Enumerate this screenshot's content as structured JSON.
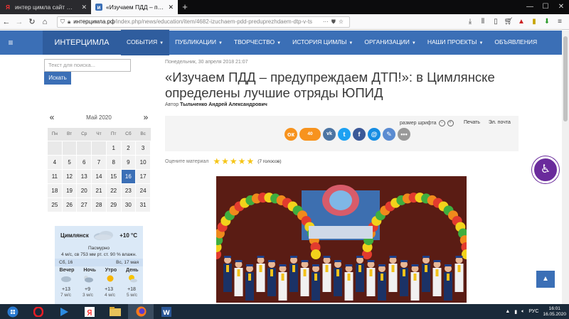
{
  "browser": {
    "tabs": [
      {
        "title": "интер цимла сайт — Яндекс: н",
        "icon": "yandex-icon",
        "active": false
      },
      {
        "title": "«Изучаем ПДД – предупрежда",
        "icon": "site-icon",
        "active": true
      }
    ],
    "url_host": "интерцимла.рф",
    "url_path": "/index.php/news/education/item/4682-izuchaem-pdd-preduprezhdaem-dtp-v-ts"
  },
  "site": {
    "logo": "ИНТЕРЦИМЛА",
    "menu": [
      {
        "label": "СОБЫТИЯ",
        "dropdown": true,
        "active": true
      },
      {
        "label": "ПУБЛИКАЦИИ",
        "dropdown": true
      },
      {
        "label": "ТВОРЧЕСТВО",
        "dropdown": true
      },
      {
        "label": "ИСТОРИЯ ЦИМЛЫ",
        "dropdown": true
      },
      {
        "label": "ОРГАНИЗАЦИИ",
        "dropdown": true
      },
      {
        "label": "НАШИ ПРОЕКТЫ",
        "dropdown": true
      },
      {
        "label": "ОБЪЯВЛЕНИЯ",
        "dropdown": false
      }
    ]
  },
  "search": {
    "placeholder": "Текст для поиска...",
    "button": "Искать"
  },
  "calendar": {
    "prev": "«",
    "next": "»",
    "month": "Май 2020",
    "weekdays": [
      "Пн",
      "Вт",
      "Ср",
      "Чт",
      "Пт",
      "Сб",
      "Вс"
    ],
    "weeks": [
      [
        "",
        "",
        "",
        "",
        "1",
        "2",
        "3"
      ],
      [
        "4",
        "5",
        "6",
        "7",
        "8",
        "9",
        "10"
      ],
      [
        "11",
        "12",
        "13",
        "14",
        "15",
        "16",
        "17"
      ],
      [
        "18",
        "19",
        "20",
        "21",
        "22",
        "23",
        "24"
      ],
      [
        "25",
        "26",
        "27",
        "28",
        "29",
        "30",
        "31"
      ]
    ],
    "today": "16"
  },
  "weather": {
    "city": "Цимлянск",
    "temp": "+10 °C",
    "condition": "Пасмурно",
    "details": "4 м/с, св   753 мм рт. ст.   90 % влажн.",
    "day1": "Сб, 16",
    "day2": "Вс, 17 мая",
    "cols": [
      "Вечер",
      "Ночь",
      "Утро",
      "День"
    ],
    "temps": [
      "+13",
      "+9",
      "+13",
      "+18"
    ],
    "winds": [
      "7 м/с",
      "3 м/с",
      "4 м/с",
      "5 м/с"
    ]
  },
  "article": {
    "date": "Понедельник, 30 апреля 2018 21:07",
    "title": "«Изучаем ПДД – предупреждаем ДТП!»: в Цимлянске определены лучшие отряды ЮПИД",
    "author_label": "Автор",
    "author": "Тыльченко Андрей Александрович",
    "font_size_label": "размер шрифта",
    "print": "Печать",
    "email": "Эл. почта",
    "ok_count": "40",
    "rating_label": "Оцените материал",
    "votes": "(7 голосов)"
  },
  "taskbar": {
    "lang": "РУС",
    "time": "16:01",
    "date": "16.05.2020"
  }
}
